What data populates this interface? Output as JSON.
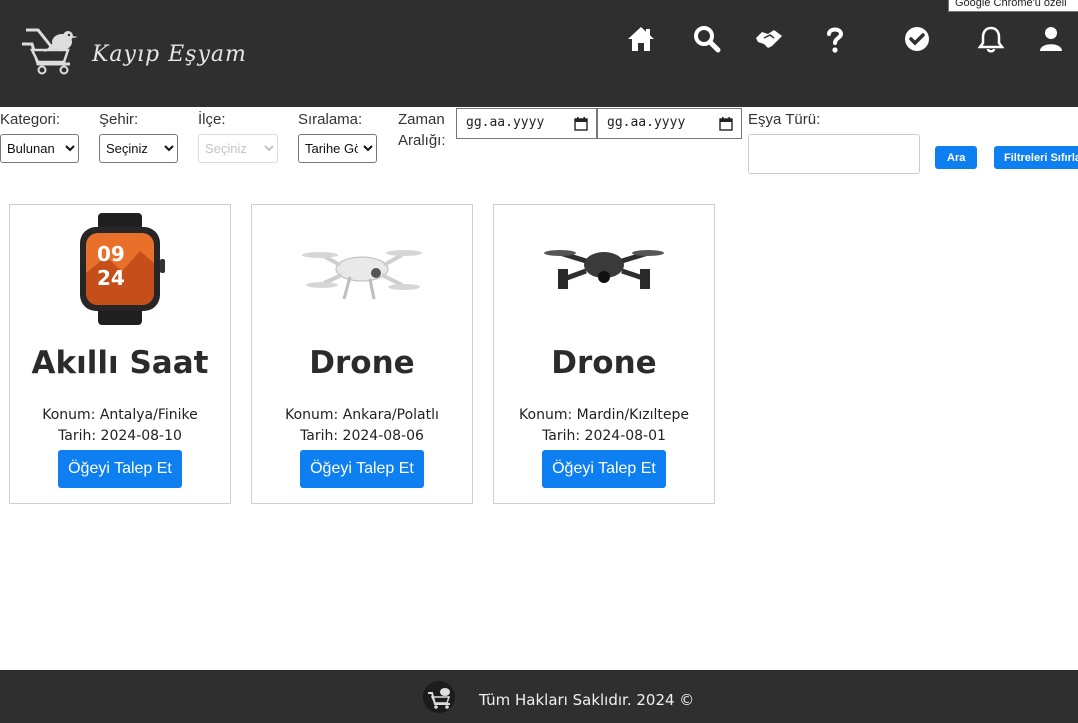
{
  "header": {
    "brand": "Kayıp Eşyam",
    "chrome_tip": "Google Chrome'u özell",
    "nav": [
      "home-icon",
      "search-icon",
      "handshake-icon",
      "question-icon",
      "check-circle-icon",
      "bell-icon",
      "user-icon"
    ]
  },
  "filters": {
    "category_label": "Kategori:",
    "category_value": "Bulunan",
    "city_label": "Şehir:",
    "city_value": "Seçiniz",
    "district_label": "İlçe:",
    "district_value": "Seçiniz",
    "sort_label": "Sıralama:",
    "sort_value": "Tarihe Göre",
    "date_label_line1": "Zaman",
    "date_label_line2": "Aralığı:",
    "date_start_placeholder": "gg.aa.yyyy",
    "date_end_placeholder": "gg.aa.yyyy",
    "item_type_label": "Eşya Türü:",
    "search_button": "Ara",
    "reset_button": "Filtreleri Sıfırla"
  },
  "items": [
    {
      "title": "Akıllı Saat",
      "location": "Konum: Antalya/Finike",
      "date": "Tarih: 2024-08-10",
      "button": "Öğeyi Talep Et",
      "image": "smartwatch"
    },
    {
      "title": "Drone",
      "location": "Konum: Ankara/Polatlı",
      "date": "Tarih: 2024-08-06",
      "button": "Öğeyi Talep Et",
      "image": "white-drone"
    },
    {
      "title": "Drone",
      "location": "Konum: Mardin/Kızıltepe",
      "date": "Tarih: 2024-08-01",
      "button": "Öğeyi Talep Et",
      "image": "black-drone"
    }
  ],
  "watch_display": {
    "hour": "09",
    "minute": "24"
  },
  "footer": {
    "text": "Tüm Hakları Saklıdır. 2024 ©"
  },
  "colors": {
    "header_bg": "#2f2f2f",
    "accent": "#0d7ff0"
  }
}
